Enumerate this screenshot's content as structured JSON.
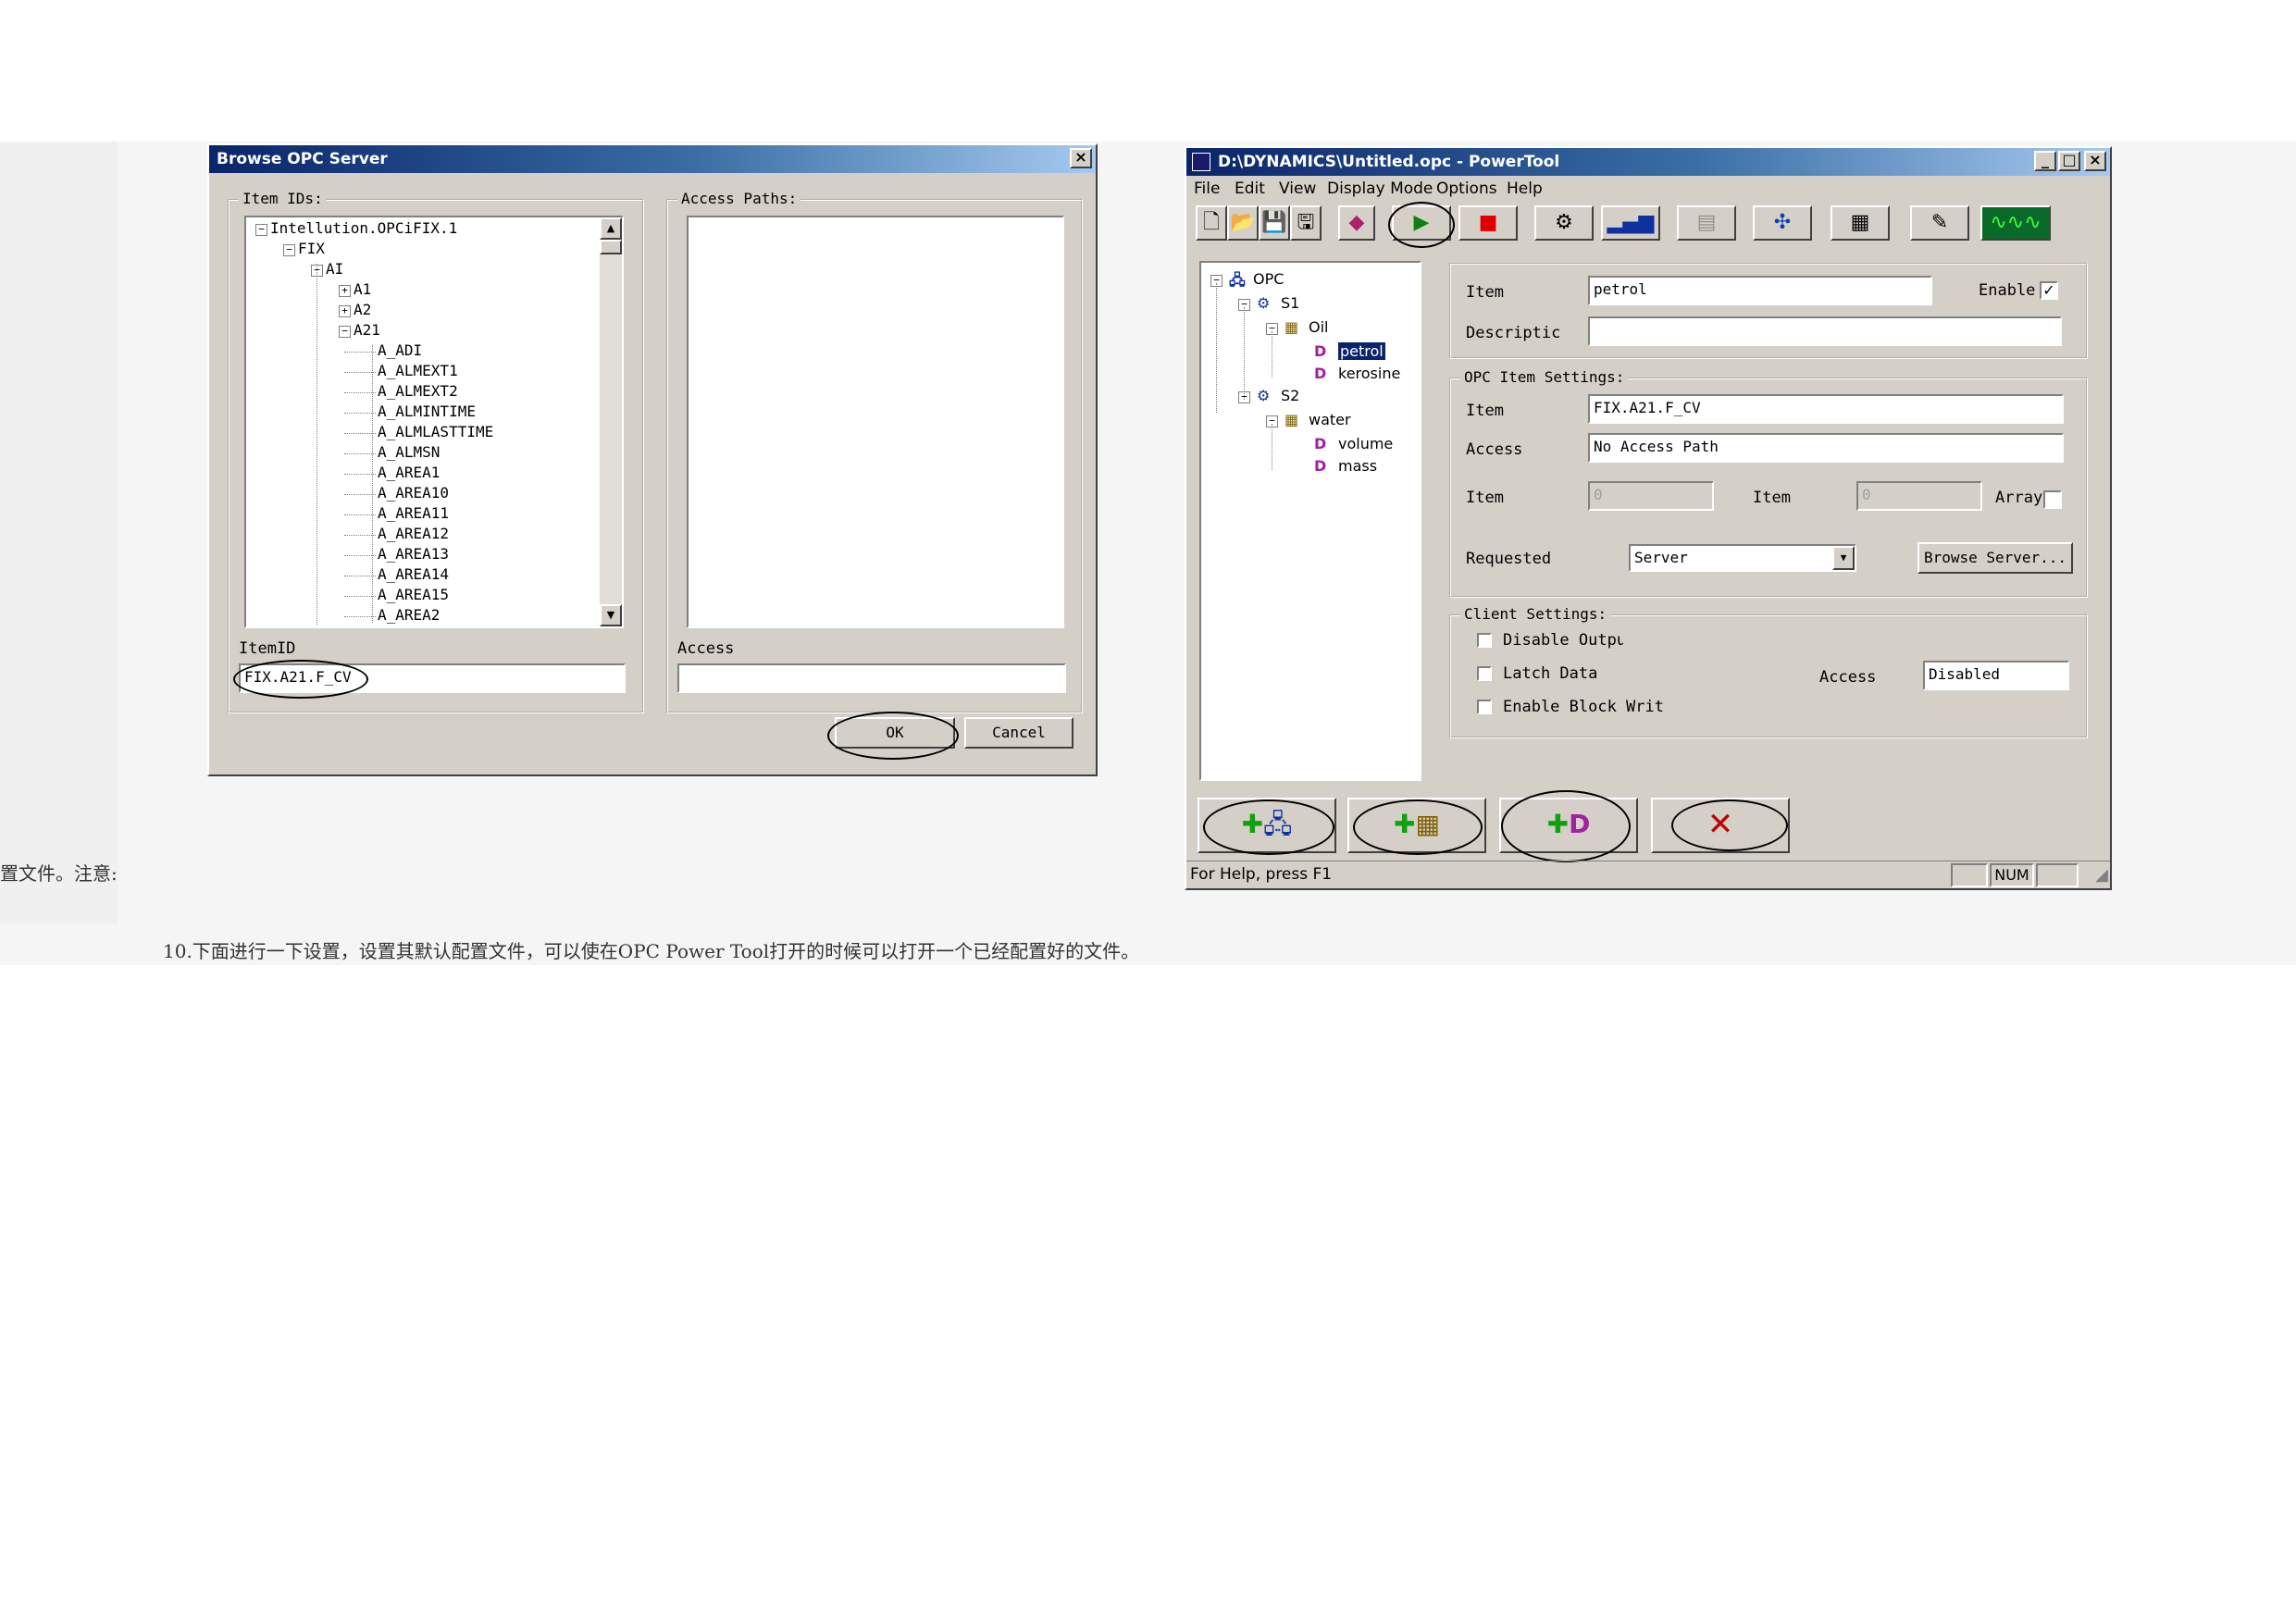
{
  "page": {
    "side_note": "置文件。注意:",
    "caption": "10.下面进行一下设置，设置其默认配置文件，可以使在OPC Power Tool打开的时候可以打开一个已经配置好的文件。"
  },
  "browse": {
    "title": "Browse OPC Server",
    "close": "×",
    "item_ids_label": "Item IDs:",
    "access_paths_label": "Access Paths:",
    "tree": [
      {
        "label": "Intellution.OPCiFIX.1",
        "toggle": "−"
      },
      {
        "label": "FIX",
        "toggle": "−"
      },
      {
        "label": "AI",
        "toggle": "−"
      },
      {
        "label": "A1",
        "toggle": "+"
      },
      {
        "label": "A2",
        "toggle": "+"
      },
      {
        "label": "A21",
        "toggle": "−"
      },
      {
        "label": "A_ADI"
      },
      {
        "label": "A_ALMEXT1"
      },
      {
        "label": "A_ALMEXT2"
      },
      {
        "label": "A_ALMINTIME"
      },
      {
        "label": "A_ALMLASTTIME"
      },
      {
        "label": "A_ALMSN"
      },
      {
        "label": "A_AREA1"
      },
      {
        "label": "A_AREA10"
      },
      {
        "label": "A_AREA11"
      },
      {
        "label": "A_AREA12"
      },
      {
        "label": "A_AREA13"
      },
      {
        "label": "A_AREA14"
      },
      {
        "label": "A_AREA15"
      },
      {
        "label": "A_AREA2"
      }
    ],
    "itemid_label": "ItemID",
    "itemid_value": "FIX.A21.F_CV",
    "access_label": "Access",
    "access_value": "",
    "ok": "OK",
    "cancel": "Cancel"
  },
  "powertool": {
    "title": "D:\\DYNAMICS\\Untitled.opc - PowerTool",
    "menu": [
      "File",
      "Edit",
      "View",
      "Display Mode",
      "Options",
      "Help"
    ],
    "tree": {
      "root": "OPC",
      "s1": "S1",
      "oil": "Oil",
      "petrol": "petrol",
      "kerosine": "kerosine",
      "s2": "S2",
      "water": "water",
      "volume": "volume",
      "mass": "mass"
    },
    "item_label": "Item",
    "item_value": "petrol",
    "enable_label": "Enable",
    "enable_check": "✓",
    "description_label": "Descriptic",
    "description_value": "",
    "opc_settings_label": "OPC Item Settings:",
    "opc_item_label": "Item",
    "opc_item_value": "FIX.A21.F_CV",
    "access_label": "Access",
    "access_value": "No Access Path",
    "item2_label": "Item",
    "item2_value": "0",
    "item3_label": "Item",
    "item3_value": "0",
    "array_label": "Array",
    "requested_label": "Requested",
    "requested_value": "Server",
    "browse_server": "Browse Server...",
    "client_settings_label": "Client Settings:",
    "disable_output": "Disable Output",
    "latch_data": "Latch Data",
    "enable_block": "Enable Block Writ",
    "client_access_label": "Access",
    "client_access_value": "Disabled",
    "status_help": "For Help, press F1",
    "status_num": "NUM"
  }
}
